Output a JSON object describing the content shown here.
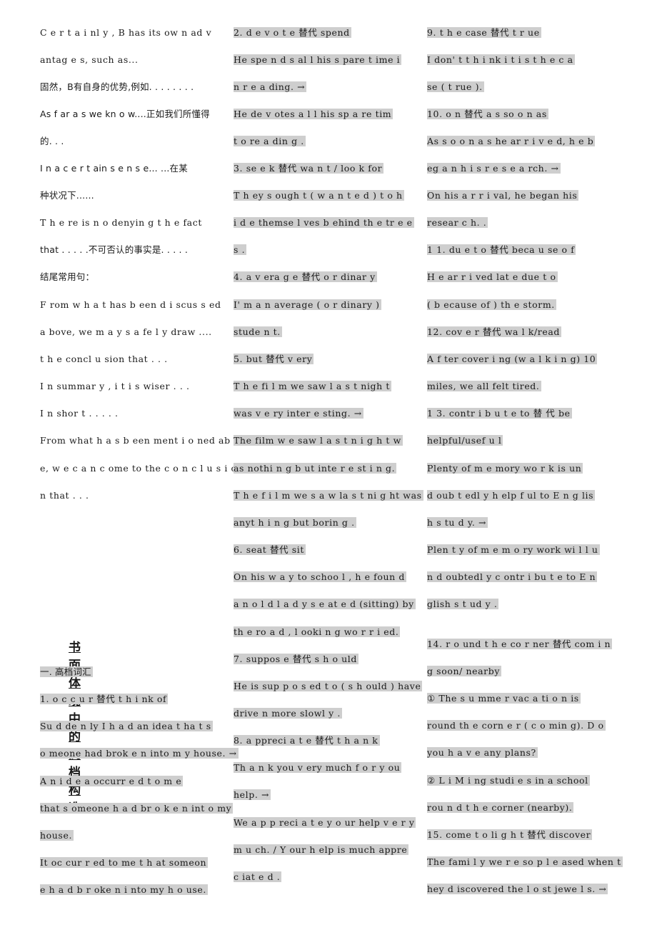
{
  "colors": {
    "highlight": "#d4d4d4",
    "text": "#1a1a1a",
    "background": "#ffffff"
  },
  "col1": {
    "lines": [
      "C e r t a i nl y ,  B has its   ow n  ad v",
      "antag e s,   such as...",
      "固然，B有自身的优势,例如.  . . . . .  . .",
      "As  f ar  a s  we  kn o w....正如我们所懂得",
      "的. . .",
      "I n    a    c e r t ain    s e n s e...  ...在某",
      "种状况下......",
      "T h e re   is  n o   denyin g    t h e  fact",
      "that   . . . . .不可否认的事实是. . . .  .",
      "结尾常用句：",
      "F rom  w h a t    has  b een   d i scus s ed",
      "a bove,  we m a y    s a fe l y  draw ....",
      "t h e   concl u sion  that   . . .",
      "I n  summar y ,    i t  i s  wiser  . . .",
      "I n    shor t . . . . .",
      "From  what  h a s   b een  ment i o ned  ab o v",
      "e, w e   c a n   c ome   to the  c o n c l u s i o",
      "n   that   . . ."
    ],
    "heading": "书面体现中的高档构造",
    "section_title": "一. 高档词汇",
    "item1": [
      "1. o c c u r  替代  t h i nk of",
      "  Su d de n ly  I   h a d   an  idea   t ha t  s",
      "o meone had brok e  n  into m y  house.   →",
      "  A n     i d e a    occurr e d    t o   m e",
      "that  s omeone  h a d   br o k e n   int o  my",
      "house.",
      "    It  oc cur r ed to me   t h at  someon",
      "e   h a d   b r oke n   i nto   my h o use."
    ]
  },
  "col2": {
    "lines": [
      "2. d e v o t e 替代 spend",
      "   He spe n d s   al l  his  s pare   t ime  i",
      "n  r e a ding.   →",
      "     He   de v otes  a l  l  his   sp a re  tim",
      "t o   re a din g .",
      "3. se e k 替代 wa n t  /  loo k   for",
      "     T h ey  s ough t  (   w a n t e d   ) t o   h",
      "i d e   themse l ves  b ehind  th e  tr e e",
      "s .",
      "4. a  v era g e   替代 o r dinar y",
      "   I'  m    a n    average  (   o  r dinary  )",
      "stude n t.",
      "5. but 替代 v ery",
      "      T h e   fi l m we   saw  l a s t  nigh t",
      "was    v e ry   inter e sting.   →",
      "    The  film w e  saw  l a s t  n i g h t   w",
      "as nothi n g  b ut  inte r e st i n g.",
      "     T h e f i l m  we s a w   la s t  ni g ht was",
      "anyt h i n g  but  borin g .",
      "6.  seat  替代 sit",
      "     On  his  w a y  to   schoo l ,  h e  foun d",
      "a n   o l d   l a d y s e at e d  (sitting)   by",
      "th e  ro a d ,    l ooki n g  wo r r i ed.",
      "7. suppos e   替代 s h o uld",
      "   He  is  sup p o s ed  t o   (  s h ould  )   have",
      "drive n   more  slowl y .",
      "8. a ppreci a t e  替代 t h a n k",
      "     Th a  n k  you   v ery   much   f  o r    y ou",
      "help.  →",
      "     We  a  p p reci a t e   y o ur  help  v e r y",
      "m u ch.    /  Y our   h elp  is   much  appre",
      "c iat e  d ."
    ]
  },
  "col3": {
    "lines": [
      "9.  t h e   case 替代   t  r ue",
      "     I  don' t    t h i nk  i t   i s  t h e   c a",
      "se  (  t rue ).",
      "10. o n 替代 a s   so o n  as",
      "      As  s o o n    a s    he ar r i v e d,  h e   b",
      "eg a n  h i  s    r e s e a rch.  →",
      "       On  his  a r r  i  val,  he    began  his",
      "resear c h. .",
      "     1  1.  du e    t o 替代 beca u se   o f",
      "          H e   ar r  i ved  lat e   due    t o",
      "     (  b ecause   of  )   th e   storm.",
      "12.  cov e  r 替代 wa l k/read",
      "       A f ter  cover i ng   (w a l k i n g)  10",
      "miles,  we  all   felt  tired.",
      "1  3. contr   i   b   u   t   e     to  替  代      be",
      "helpful/usef u l",
      "          Plenty  of  m e mory  wo r k  is  un",
      "     d oub t edl y    h elp f ul  to  E n g lis",
      "     h   s tu d y.    →",
      "        Plen t y  of  m e m o ry   work  wi l l   u",
      "n d oubtedl y    c ontr i bu t e    to    E n",
      "glish   s t ud y .",
      "14. r o  und   t h e    co r ner    替代  com i n",
      "g    soon/  nearby",
      "     ①  The   s u mme r    vac a ti o n    is",
      "round   th e   corn e r  (  c o min g).  D o",
      "you h a v e   any  plans?",
      "②   L i   M i ng  studi e s    in    a   school",
      "rou n d  t h e    corner    (nearby).",
      "     15.  come   t o  li g h t 替代 discover",
      "The   fami l y  we r e   so  p l e ased  when   t",
      "hey    d iscovered  the  l o st  jewe l s.   →"
    ]
  }
}
